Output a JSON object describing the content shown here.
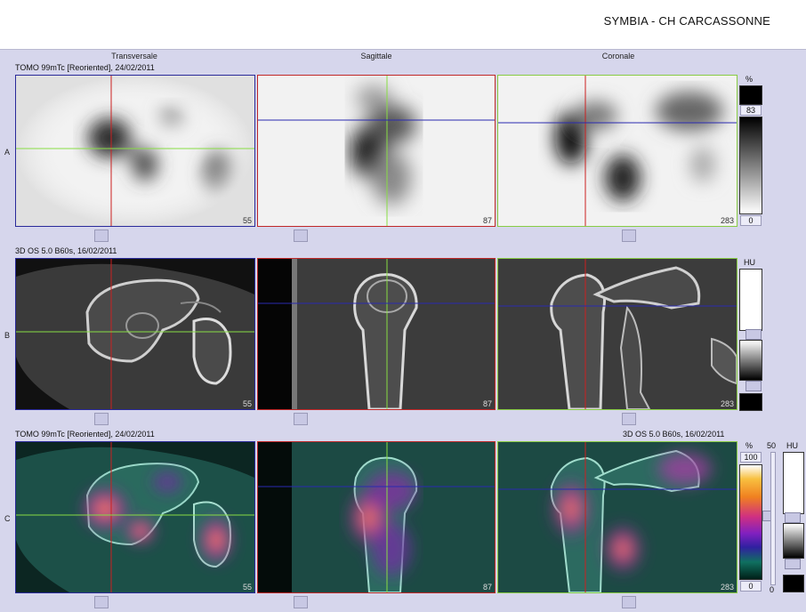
{
  "header": {
    "title": "SYMBIA - CH CARCASSONNE"
  },
  "columns": [
    "Transversale",
    "Sagittale",
    "Coronale"
  ],
  "rows": {
    "A": {
      "letter": "A",
      "series_left": "TOMO 99mTc [Reoriented], 24/02/2011",
      "series_right": "",
      "slices": [
        "55",
        "87",
        "283"
      ]
    },
    "B": {
      "letter": "B",
      "series_left": "3D  OS  5.0  B60s, 16/02/2011",
      "series_right": "",
      "slices": [
        "55",
        "87",
        "283"
      ]
    },
    "C": {
      "letter": "C",
      "series_left": "TOMO 99mTc [Reoriented], 24/02/2011",
      "series_right": "3D  OS  5.0  B60s, 16/02/2011",
      "slices": [
        "55",
        "87",
        "283"
      ]
    }
  },
  "scales": {
    "a": {
      "unit": "%",
      "upper": "83",
      "lower": "0"
    },
    "b": {
      "unit": "HU"
    },
    "c": {
      "unit": "%",
      "upper": "100",
      "lower": "0",
      "window_value": "50",
      "unit2": "HU",
      "lower2": "0"
    }
  },
  "colors": {
    "background": "#d6d6ec",
    "crosshair_red": "#cc2020",
    "crosshair_green": "#88dd44",
    "crosshair_blue": "#2a2ab0",
    "border_red": "#c02828",
    "border_blue": "#2a2a9a",
    "border_green": "#88cc44"
  }
}
